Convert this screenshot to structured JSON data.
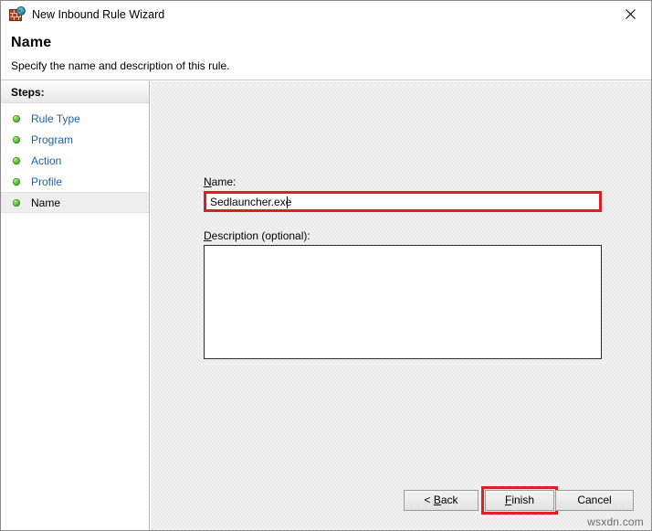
{
  "window": {
    "title": "New Inbound Rule Wizard",
    "icon": "firewall-globe-icon",
    "close_label": "×"
  },
  "header": {
    "title": "Name",
    "subtitle": "Specify the name and description of this rule."
  },
  "sidebar": {
    "header": "Steps:",
    "items": [
      {
        "label": "Rule Type",
        "state": "completed"
      },
      {
        "label": "Program",
        "state": "completed"
      },
      {
        "label": "Action",
        "state": "completed"
      },
      {
        "label": "Profile",
        "state": "completed"
      },
      {
        "label": "Name",
        "state": "current"
      }
    ]
  },
  "form": {
    "name_label_accel": "N",
    "name_label_rest": "ame:",
    "name_value": "Sedlauncher.exe",
    "name_placeholder": "",
    "description_label_accel": "D",
    "description_label_rest": "escription (optional):",
    "description_value": "",
    "description_placeholder": ""
  },
  "buttons": {
    "back": {
      "prefix": "< ",
      "accel": "B",
      "rest": "ack"
    },
    "finish": {
      "accel": "F",
      "rest": "inish"
    },
    "cancel": {
      "label": "Cancel"
    }
  },
  "watermark": "wsxdn.com",
  "colors": {
    "highlight_red": "#e31b23",
    "link_blue": "#1b5fb4",
    "step_green": "#5fc234",
    "panel_gray": "#f2f2f2"
  }
}
